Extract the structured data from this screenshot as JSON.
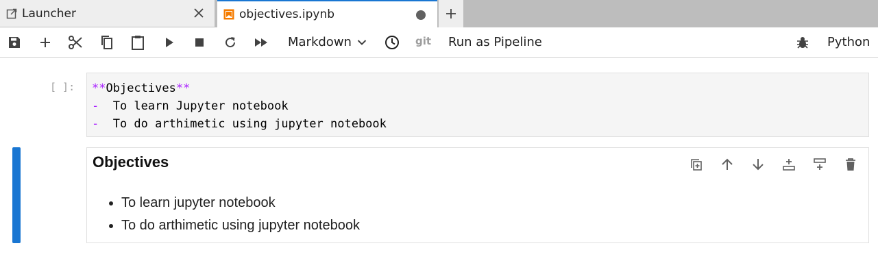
{
  "tabs": {
    "launcher": {
      "label": "Launcher",
      "icon": "launcher-icon"
    },
    "notebook": {
      "label": "objectives.ipynb",
      "icon": "notebook-icon",
      "dirty": true
    }
  },
  "toolbar": {
    "cell_type": "Markdown",
    "git_label": "git",
    "pipeline_label": "Run as Pipeline",
    "kernel_name": "Python",
    "icons": [
      "save-icon",
      "add-icon",
      "cut-icon",
      "copy-icon",
      "paste-icon",
      "run-icon",
      "stop-icon",
      "restart-icon",
      "run-all-icon",
      "clock-icon",
      "bug-icon"
    ]
  },
  "cells": {
    "code": {
      "prompt": "[ ]:",
      "lines": [
        {
          "prefix": "**",
          "text": "Objectives",
          "suffix": "**"
        },
        {
          "prefix": "-",
          "text": "  To learn Jupyter notebook",
          "suffix": ""
        },
        {
          "prefix": "-",
          "text": "  To do arthimetic using jupyter notebook",
          "suffix": ""
        }
      ]
    },
    "markdown": {
      "heading": "Objectives",
      "items": [
        "To learn jupyter notebook",
        "To do arthimetic using jupyter notebook"
      ]
    }
  },
  "colors": {
    "accent": "#1976d2",
    "markdown_syntax": "#aa22ff",
    "icon": "#424242"
  }
}
